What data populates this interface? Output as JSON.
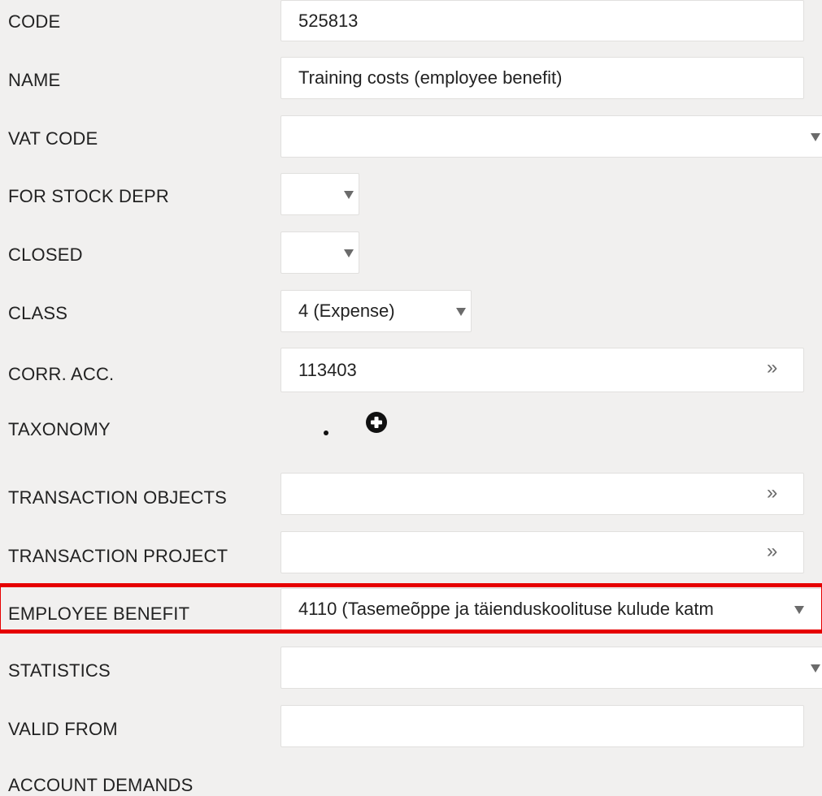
{
  "form": {
    "code": {
      "label": "CODE",
      "value": "525813"
    },
    "name": {
      "label": "NAME",
      "value": "Training costs (employee benefit)"
    },
    "vat_code": {
      "label": "VAT CODE",
      "value": ""
    },
    "for_stock_depr": {
      "label": "FOR STOCK DEPR",
      "value": ""
    },
    "closed": {
      "label": "CLOSED",
      "value": ""
    },
    "class": {
      "label": "CLASS",
      "value": "4 (Expense)"
    },
    "corr_acc": {
      "label": "CORR. ACC.",
      "value": "113403"
    },
    "taxonomy": {
      "label": "TAXONOMY"
    },
    "transaction_objects": {
      "label": "TRANSACTION OBJECTS",
      "value": ""
    },
    "transaction_project": {
      "label": "TRANSACTION PROJECT",
      "value": ""
    },
    "employee_benefit": {
      "label": "EMPLOYEE BENEFIT",
      "value": "4110 (Tasemeõppe ja täienduskoolituse kulude katm"
    },
    "statistics": {
      "label": "STATISTICS",
      "value": ""
    },
    "valid_from": {
      "label": "VALID FROM",
      "value": ""
    },
    "account_demands": {
      "label": "ACCOUNT DEMANDS"
    }
  },
  "icons": {
    "dropdown": "triangle-down",
    "lookup": "double-chevron-right",
    "add": "plus-circle"
  },
  "colors": {
    "background": "#f1f0ef",
    "field_bg": "#ffffff",
    "highlight": "#e60000",
    "arrow": "#6b6b6b"
  }
}
